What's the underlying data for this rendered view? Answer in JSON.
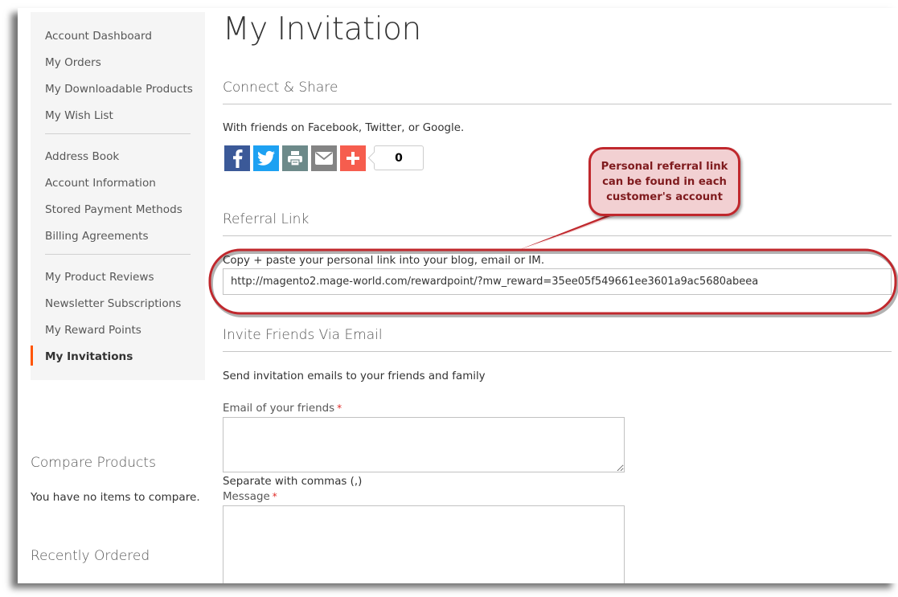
{
  "sidebar": {
    "nav_groups": [
      [
        "Account Dashboard",
        "My Orders",
        "My Downloadable Products",
        "My Wish List"
      ],
      [
        "Address Book",
        "Account Information",
        "Stored Payment Methods",
        "Billing Agreements"
      ],
      [
        "My Product Reviews",
        "Newsletter Subscriptions",
        "My Reward Points",
        "My Invitations"
      ]
    ],
    "items": {
      "account_dashboard": "Account Dashboard",
      "my_orders": "My Orders",
      "my_downloadable_products": "My Downloadable Products",
      "my_wish_list": "My Wish List",
      "address_book": "Address Book",
      "account_information": "Account Information",
      "stored_payment_methods": "Stored Payment Methods",
      "billing_agreements": "Billing Agreements",
      "my_product_reviews": "My Product Reviews",
      "newsletter_subscriptions": "Newsletter Subscriptions",
      "my_reward_points": "My Reward Points",
      "my_invitations": "My Invitations"
    },
    "active_item": "My Invitations",
    "active_color": "#ff5501",
    "compare": {
      "title": "Compare Products",
      "text": "You have no items to compare."
    },
    "recently_ordered": {
      "title": "Recently Ordered"
    }
  },
  "main": {
    "page_title": "My Invitation",
    "connect": {
      "title": "Connect & Share",
      "text": "With friends on Facebook, Twitter, or Google.",
      "buttons": [
        {
          "name": "facebook",
          "icon": "facebook-icon",
          "color": "#3b5998"
        },
        {
          "name": "twitter",
          "icon": "twitter-icon",
          "color": "#1da1f2"
        },
        {
          "name": "print",
          "icon": "print-icon",
          "color": "#6d8a8a"
        },
        {
          "name": "email",
          "icon": "email-icon",
          "color": "#848484"
        },
        {
          "name": "more",
          "icon": "plus-icon",
          "color": "#f65d4e"
        }
      ],
      "share_count": "0"
    },
    "referral": {
      "title": "Referral Link",
      "hint": "Copy + paste your personal link into your blog, email or IM.",
      "link": "http://magento2.mage-world.com/rewardpoint/?mw_reward=35ee05f549661ee3601a9ac5680abeea"
    },
    "invite": {
      "title": "Invite Friends Via Email",
      "text": "Send invitation emails to your friends and family",
      "email_label": "Email of your friends",
      "email_value": "",
      "email_note": "Separate with commas (,)",
      "message_label": "Message",
      "message_value": "",
      "required_mark": "*"
    }
  },
  "annotation": {
    "callout_text": "Personal referral link can be found in each customer's account",
    "callout_lines": [
      "Personal referral link",
      "can be found in each",
      "customer's account"
    ],
    "color": "#c0282d",
    "fill": "#f2d0d2"
  }
}
